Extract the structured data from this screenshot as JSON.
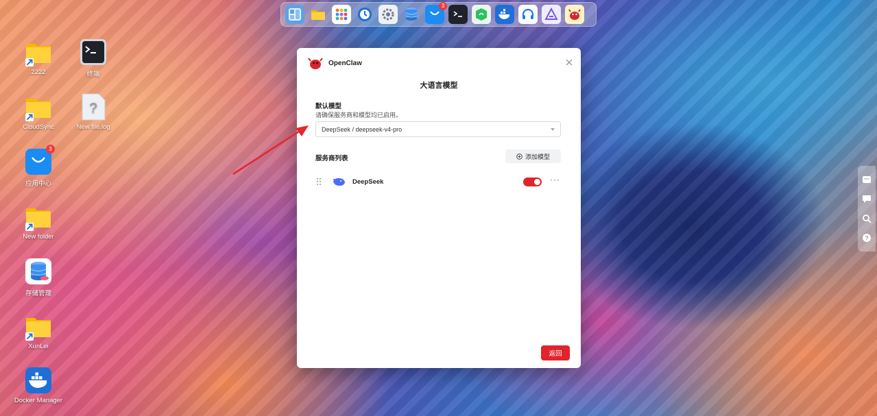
{
  "dock": {
    "items": [
      {
        "name": "file-manager-icon"
      },
      {
        "name": "folder-icon"
      },
      {
        "name": "app-grid-icon"
      },
      {
        "name": "clock-icon"
      },
      {
        "name": "settings-icon"
      },
      {
        "name": "storage-icon"
      },
      {
        "name": "app-store-icon",
        "badge": "3"
      },
      {
        "name": "terminal-icon"
      },
      {
        "name": "android-icon"
      },
      {
        "name": "docker-icon"
      },
      {
        "name": "headset-icon"
      },
      {
        "name": "triangle-app-icon"
      },
      {
        "name": "openclaw-icon"
      }
    ]
  },
  "desktop": {
    "icons": [
      {
        "label": "2222"
      },
      {
        "label": "终端"
      },
      {
        "label": "CloudSync"
      },
      {
        "label": "New file.log"
      },
      {
        "label": "应用中心",
        "badge": "3"
      },
      {
        "label": "New folder"
      },
      {
        "label": "存储管理"
      },
      {
        "label": "XunLei"
      },
      {
        "label": "Docker Manager"
      }
    ]
  },
  "dialog": {
    "app_name": "OpenClaw",
    "title": "大语言模型",
    "default_model_label": "默认模型",
    "default_model_desc": "请确保服务商和模型均已启用。",
    "selected_model": "DeepSeek / deepseek-v4-pro",
    "provider_list_label": "服务商列表",
    "add_model_label": "添加模型",
    "providers": [
      {
        "name": "DeepSeek",
        "enabled": true
      }
    ],
    "back_label": "返回"
  },
  "colors": {
    "accent": "#e0242b"
  }
}
